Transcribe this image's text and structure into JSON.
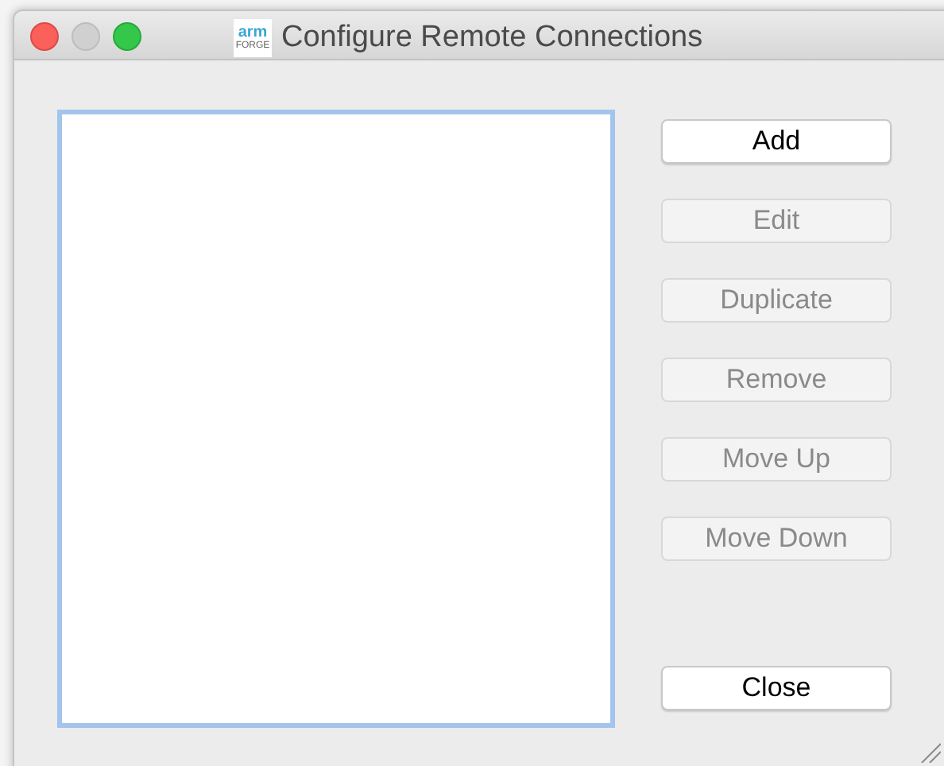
{
  "window": {
    "title": "Configure Remote Connections",
    "app_logo": {
      "line_1": "arm",
      "line_2": "FORGE"
    }
  },
  "buttons": [
    {
      "label": "Add",
      "disabled": false
    },
    {
      "label": "Edit",
      "disabled": true
    },
    {
      "label": "Duplicate",
      "disabled": true
    },
    {
      "label": "Remove",
      "disabled": true
    },
    {
      "label": "Move Up",
      "disabled": true
    },
    {
      "label": "Move Down",
      "disabled": true
    }
  ],
  "close_button": {
    "label": "Close",
    "disabled": false
  }
}
